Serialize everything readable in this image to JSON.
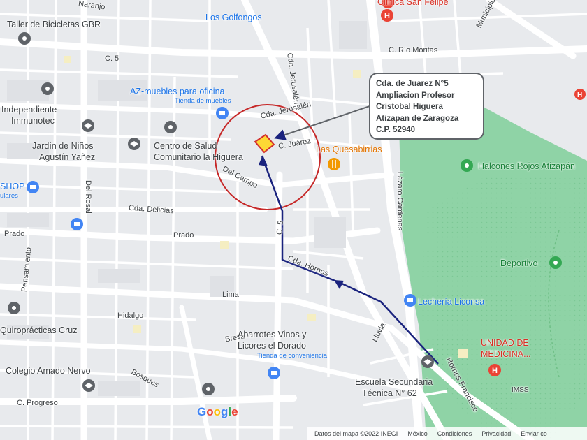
{
  "address_callout": {
    "lines": [
      "Cda. de Juarez N°5",
      "Ampliacion Profesor",
      "Cristobal Higuera",
      "Atizapan de Zaragoza",
      "C.P. 52940"
    ]
  },
  "streets": {
    "naranjo": "Naranjo",
    "c5_top": "C. 5",
    "rio_moritas": "C. Río Moritas",
    "municipio_libre": "Municipio Lib",
    "cda_jerusalen": "Cda. Jerusalén",
    "cda_jerusalen2": "Cda. Jerusalén",
    "c_juarez": "C. Juárez",
    "del_campo": "Del Campo",
    "cda_delicias": "Cda. Delicias",
    "del_rosal": "Del Rosal",
    "prado_left": "Prado",
    "prado_mid": "Prado",
    "c5_mid": "C. 5",
    "cda_hornos": "Cda. Hornos",
    "lazaro_cardenas": "Lázaro Cárdenas",
    "pensamiento": "Pensamiento",
    "lima": "Lima",
    "hidalgo": "Hidalgo",
    "breva": "Breva",
    "lluvia": "Lluvia",
    "bosques": "Bosques",
    "c_progreso": "C. Progreso",
    "hornos_francisco": "Hornos Francisco",
    "imss": "IMSS"
  },
  "places": {
    "clinica": "Clínica San Felipe",
    "golfongos": "Los Golfongos",
    "taller": "Taller de Bicicletas GBR",
    "az_muebles": "AZ-muebles para oficina",
    "az_muebles_sub": "Tienda de muebles",
    "independiente_1": "Independiente",
    "independiente_2": "Immunotec",
    "jardin_1": "Jardín de Niños",
    "jardin_2": "Agustín Yañez",
    "centro_1": "Centro de Salud",
    "centro_2": "Comunitario la Higuera",
    "quesabirrias": "Las Quesabirrias",
    "halcones": "Halcones Rojos Atizapán",
    "shop": "SHOP",
    "shop_sub": "ulares",
    "deportivo": "Deportivo",
    "lecheria": "Lechería Liconsa",
    "quiro": "Quiroprácticas Cruz",
    "abarrotes_1": "Abarrotes Vinos y",
    "abarrotes_2": "Licores el Dorado",
    "abarrotes_sub": "Tienda de conveniencia",
    "unidad_1": "UNIDAD DE",
    "unidad_2": "MEDICINA...",
    "colegio": "Colegio Amado Nervo",
    "escuela_1": "Escuela Secundaria",
    "escuela_2": "Técnica N° 62"
  },
  "logo": {
    "letters": [
      "G",
      "o",
      "o",
      "g",
      "l",
      "e"
    ],
    "colors": [
      "#4285f4",
      "#ea4335",
      "#fbbc05",
      "#4285f4",
      "#34a853",
      "#ea4335"
    ]
  },
  "footer": {
    "map_data": "Datos del mapa ©2022 INEGI",
    "country": "México",
    "terms": "Condiciones",
    "privacy": "Privacidad",
    "feedback": "Enviar co"
  },
  "colors": {
    "road": "#ffffff",
    "block": "#e8eaed",
    "park": "#8fd3a6",
    "route": "#1a237e",
    "marker": "#fdd835",
    "circle": "#c62828",
    "poi_gray": "#5f6368",
    "poi_blue": "#4285f4",
    "poi_red": "#ea4335",
    "poi_orange": "#f29900",
    "poi_green": "#34a853"
  },
  "icons": {
    "route": "route-arrow-icon",
    "property": "property-marker-icon",
    "school": "school-icon",
    "hospital": "hospital-icon",
    "shop": "shopping-bag-icon",
    "restaurant": "fork-knife-icon",
    "place": "place-pin-icon",
    "park": "park-pin-icon"
  }
}
